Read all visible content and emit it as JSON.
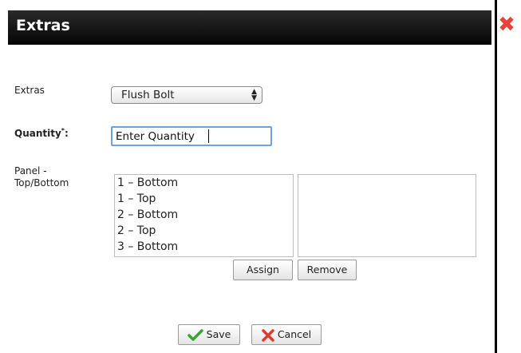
{
  "dialog": {
    "title": "Extras",
    "close_glyph": "✖"
  },
  "form": {
    "extras_label": "Extras",
    "extras_value": "Flush Bolt",
    "quantity_label": "Quantity",
    "quantity_required": "*",
    "quantity_colon": ":",
    "quantity_value": "Enter Quantity",
    "panel_label_line1": "Panel -",
    "panel_label_line2": "Top/Bottom"
  },
  "panel_options": [
    "1 – Bottom",
    "1 – Top",
    "2 – Bottom",
    "2 – Top",
    "3 – Bottom"
  ],
  "buttons": {
    "assign": "Assign",
    "remove": "Remove",
    "save": "Save",
    "cancel": "Cancel"
  },
  "icons": {
    "close": "close-icon",
    "save": "checkmark-icon",
    "cancel": "x-icon"
  },
  "colors": {
    "titlebar": "#111111",
    "close": "#e8423a",
    "input_focus": "#6fa0e0",
    "save_check": "#3aa335",
    "cancel_x": "#e0392f"
  }
}
